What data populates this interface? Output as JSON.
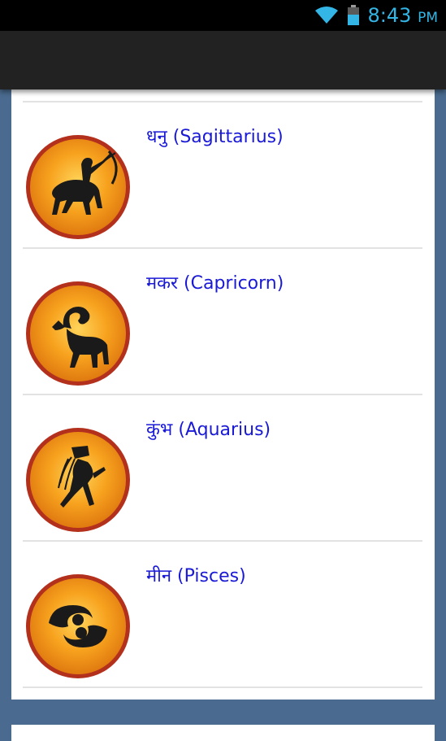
{
  "status_bar": {
    "time": "8:43",
    "ampm": "PM",
    "icons": [
      "wifi-icon",
      "battery-icon"
    ]
  },
  "zodiac_list": [
    {
      "name": "धनु (Sagittarius)",
      "icon": "sagittarius-icon"
    },
    {
      "name": "मकर (Capricorn)",
      "icon": "capricorn-icon"
    },
    {
      "name": "कुंभ (Aquarius)",
      "icon": "aquarius-icon"
    },
    {
      "name": "मीन (Pisces)",
      "icon": "pisces-icon"
    }
  ],
  "colors": {
    "accent": "#33b5e5",
    "link_text": "#1a1ad6",
    "sign_fill": "#f39a1a",
    "sign_ring": "#b3301c",
    "background": "#4a6b8f"
  }
}
